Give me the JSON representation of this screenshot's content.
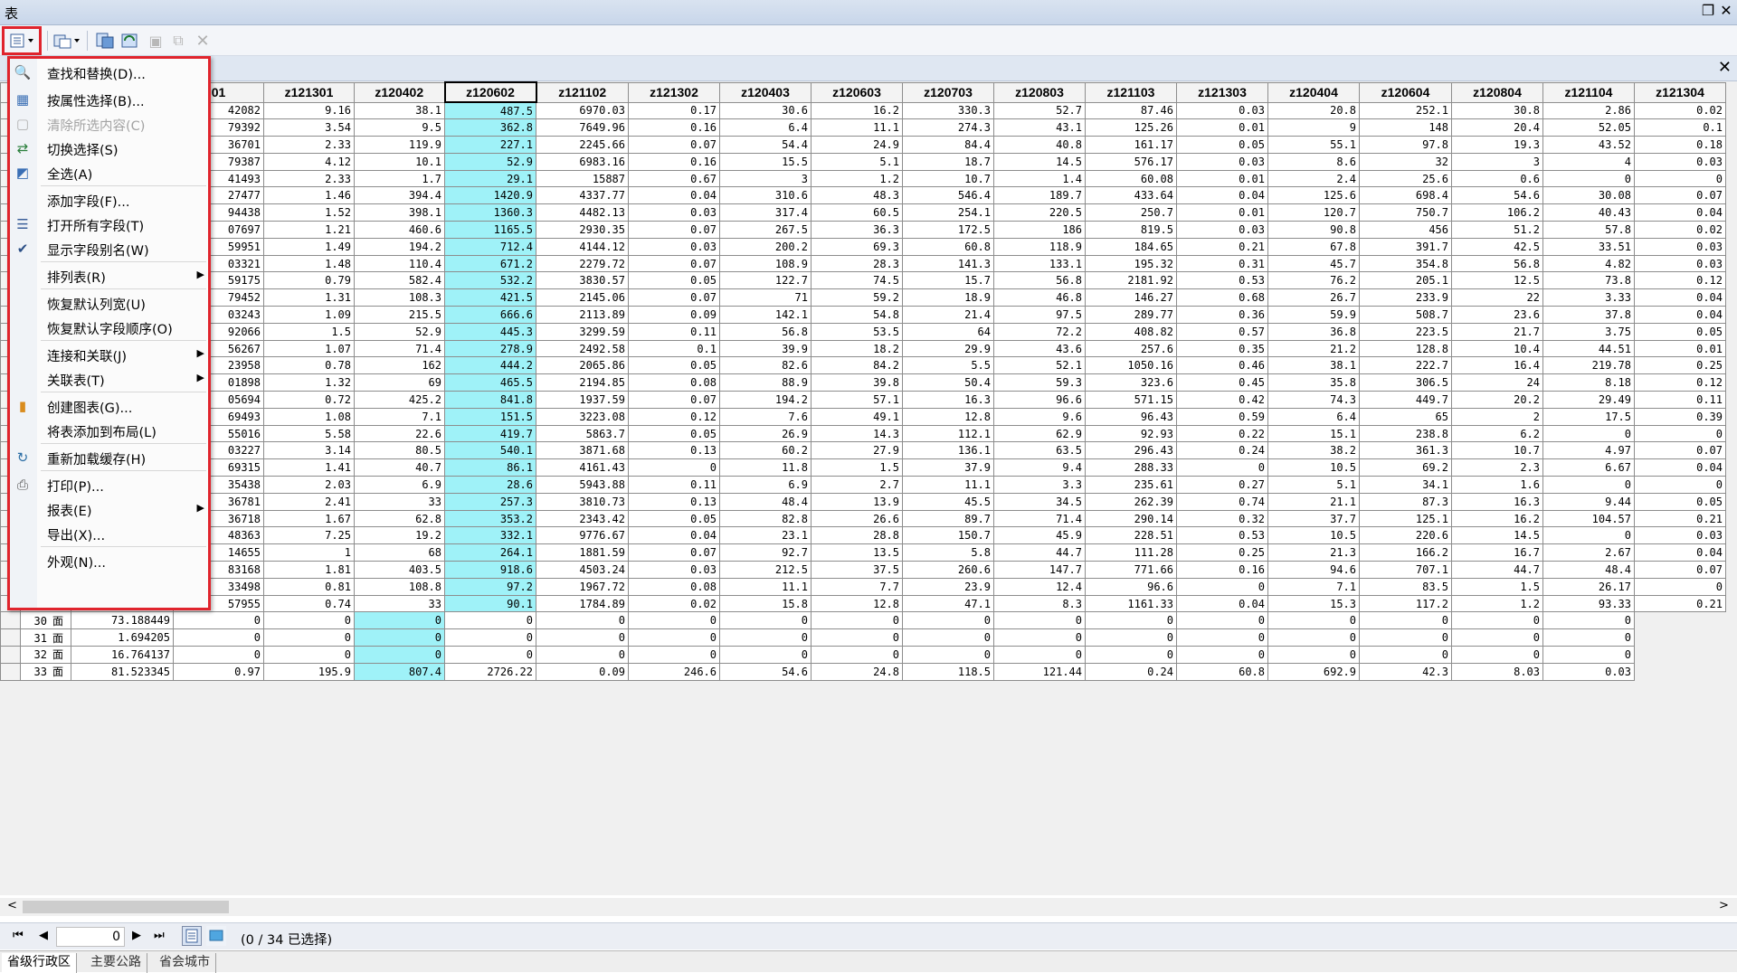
{
  "window": {
    "title": "表",
    "restore_icon": "restore-icon",
    "close_icon": "close-icon"
  },
  "toolbar": {
    "options_icon": "table-options-icon",
    "related_icon": "related-tables-icon",
    "select_icons": [
      "select-by-attributes-icon",
      "switch-selection-icon",
      "clear-selection-icon",
      "zoom-to-selected-icon",
      "delete-icon"
    ]
  },
  "menu": {
    "items": [
      {
        "label": "查找和替换(D)...",
        "icon": "binoculars-icon",
        "enabled": true
      },
      {
        "label": "按属性选择(B)...",
        "icon": "select-attributes-icon",
        "enabled": true
      },
      {
        "label": "清除所选内容(C)",
        "icon": "clear-selection-icon",
        "enabled": false
      },
      {
        "label": "切换选择(S)",
        "icon": "switch-selection-icon",
        "enabled": true
      },
      {
        "label": "全选(A)",
        "icon": "select-all-icon",
        "enabled": true
      },
      {
        "label": "添加字段(F)...",
        "icon": "",
        "enabled": true
      },
      {
        "label": "打开所有字段(T)",
        "icon": "fields-icon",
        "enabled": true
      },
      {
        "label": "显示字段别名(W)",
        "icon": "check-icon",
        "enabled": true
      },
      {
        "label": "排列表(R)",
        "icon": "",
        "enabled": true,
        "submenu": true
      },
      {
        "label": "恢复默认列宽(U)",
        "icon": "",
        "enabled": true
      },
      {
        "label": "恢复默认字段顺序(O)",
        "icon": "",
        "enabled": true
      },
      {
        "label": "连接和关联(J)",
        "icon": "",
        "enabled": true,
        "submenu": true
      },
      {
        "label": "关联表(T)",
        "icon": "",
        "enabled": true,
        "submenu": true
      },
      {
        "label": "创建图表(G)...",
        "icon": "chart-icon",
        "enabled": true
      },
      {
        "label": "将表添加到布局(L)",
        "icon": "",
        "enabled": true
      },
      {
        "label": "重新加载缓存(H)",
        "icon": "reload-icon",
        "enabled": true
      },
      {
        "label": "打印(P)...",
        "icon": "print-icon",
        "enabled": true
      },
      {
        "label": "报表(E)",
        "icon": "",
        "enabled": true,
        "submenu": true
      },
      {
        "label": "导出(X)...",
        "icon": "",
        "enabled": true
      },
      {
        "label": "外观(N)...",
        "icon": "",
        "enabled": true
      }
    ]
  },
  "table": {
    "columns": [
      "01",
      "z121301",
      "z120402",
      "z120602",
      "z121102",
      "z121302",
      "z120403",
      "z120603",
      "z120703",
      "z120803",
      "z121103",
      "z121303",
      "z120404",
      "z120604",
      "z120804",
      "z121104",
      "z121304"
    ],
    "selected_column": "z120602",
    "rows": [
      [
        "42082",
        "9.16",
        "38.1",
        "487.5",
        "6970.03",
        "0.17",
        "30.6",
        "16.2",
        "330.3",
        "52.7",
        "87.46",
        "0.03",
        "20.8",
        "252.1",
        "30.8",
        "2.86",
        "0.02"
      ],
      [
        "79392",
        "3.54",
        "9.5",
        "362.8",
        "7649.96",
        "0.16",
        "6.4",
        "11.1",
        "274.3",
        "43.1",
        "125.26",
        "0.01",
        "9",
        "148",
        "20.4",
        "52.05",
        "0.1"
      ],
      [
        "36701",
        "2.33",
        "119.9",
        "227.1",
        "2245.66",
        "0.07",
        "54.4",
        "24.9",
        "84.4",
        "40.8",
        "161.17",
        "0.05",
        "55.1",
        "97.8",
        "19.3",
        "43.52",
        "0.18"
      ],
      [
        "79387",
        "4.12",
        "10.1",
        "52.9",
        "6983.16",
        "0.16",
        "15.5",
        "5.1",
        "18.7",
        "14.5",
        "576.17",
        "0.03",
        "8.6",
        "32",
        "3",
        "4",
        "0.03"
      ],
      [
        "41493",
        "2.33",
        "1.7",
        "29.1",
        "15887",
        "0.67",
        "3",
        "1.2",
        "10.7",
        "1.4",
        "60.08",
        "0.01",
        "2.4",
        "25.6",
        "0.6",
        "0",
        "0"
      ],
      [
        "27477",
        "1.46",
        "394.4",
        "1420.9",
        "4337.77",
        "0.04",
        "310.6",
        "48.3",
        "546.4",
        "189.7",
        "433.64",
        "0.04",
        "125.6",
        "698.4",
        "54.6",
        "30.08",
        "0.07"
      ],
      [
        "94438",
        "1.52",
        "398.1",
        "1360.3",
        "4482.13",
        "0.03",
        "317.4",
        "60.5",
        "254.1",
        "220.5",
        "250.7",
        "0.01",
        "120.7",
        "750.7",
        "106.2",
        "40.43",
        "0.04"
      ],
      [
        "07697",
        "1.21",
        "460.6",
        "1165.5",
        "2930.35",
        "0.07",
        "267.5",
        "36.3",
        "172.5",
        "186",
        "819.5",
        "0.03",
        "90.8",
        "456",
        "51.2",
        "57.8",
        "0.02"
      ],
      [
        "59951",
        "1.49",
        "194.2",
        "712.4",
        "4144.12",
        "0.03",
        "200.2",
        "69.3",
        "60.8",
        "118.9",
        "184.65",
        "0.21",
        "67.8",
        "391.7",
        "42.5",
        "33.51",
        "0.03"
      ],
      [
        "03321",
        "1.48",
        "110.4",
        "671.2",
        "2279.72",
        "0.07",
        "108.9",
        "28.3",
        "141.3",
        "133.1",
        "195.32",
        "0.31",
        "45.7",
        "354.8",
        "56.8",
        "4.82",
        "0.03"
      ],
      [
        "59175",
        "0.79",
        "582.4",
        "532.2",
        "3830.57",
        "0.05",
        "122.7",
        "74.5",
        "15.7",
        "56.8",
        "2181.92",
        "0.53",
        "76.2",
        "205.1",
        "12.5",
        "73.8",
        "0.12"
      ],
      [
        "79452",
        "1.31",
        "108.3",
        "421.5",
        "2145.06",
        "0.07",
        "71",
        "59.2",
        "18.9",
        "46.8",
        "146.27",
        "0.68",
        "26.7",
        "233.9",
        "22",
        "3.33",
        "0.04"
      ],
      [
        "03243",
        "1.09",
        "215.5",
        "666.6",
        "2113.89",
        "0.09",
        "142.1",
        "54.8",
        "21.4",
        "97.5",
        "289.77",
        "0.36",
        "59.9",
        "508.7",
        "23.6",
        "37.8",
        "0.04"
      ],
      [
        "92066",
        "1.5",
        "52.9",
        "445.3",
        "3299.59",
        "0.11",
        "56.8",
        "53.5",
        "64",
        "72.2",
        "408.82",
        "0.57",
        "36.8",
        "223.5",
        "21.7",
        "3.75",
        "0.05"
      ],
      [
        "56267",
        "1.07",
        "71.4",
        "278.9",
        "2492.58",
        "0.1",
        "39.9",
        "18.2",
        "29.9",
        "43.6",
        "257.6",
        "0.35",
        "21.2",
        "128.8",
        "10.4",
        "44.51",
        "0.01"
      ],
      [
        "23958",
        "0.78",
        "162",
        "444.2",
        "2065.86",
        "0.05",
        "82.6",
        "84.2",
        "5.5",
        "52.1",
        "1050.16",
        "0.46",
        "38.1",
        "222.7",
        "16.4",
        "219.78",
        "0.25"
      ],
      [
        "01898",
        "1.32",
        "69",
        "465.5",
        "2194.85",
        "0.08",
        "88.9",
        "39.8",
        "50.4",
        "59.3",
        "323.6",
        "0.45",
        "35.8",
        "306.5",
        "24",
        "8.18",
        "0.12"
      ],
      [
        "05694",
        "0.72",
        "425.2",
        "841.8",
        "1937.59",
        "0.07",
        "194.2",
        "57.1",
        "16.3",
        "96.6",
        "571.15",
        "0.42",
        "74.3",
        "449.7",
        "20.2",
        "29.49",
        "0.11"
      ],
      [
        "69493",
        "1.08",
        "7.1",
        "151.5",
        "3223.08",
        "0.12",
        "7.6",
        "49.1",
        "12.8",
        "9.6",
        "96.43",
        "0.59",
        "6.4",
        "65",
        "2",
        "17.5",
        "0.39"
      ],
      [
        "55016",
        "5.58",
        "22.6",
        "419.7",
        "5863.7",
        "0.05",
        "26.9",
        "14.3",
        "112.1",
        "62.9",
        "92.93",
        "0.22",
        "15.1",
        "238.8",
        "6.2",
        "0",
        "0"
      ],
      [
        "03227",
        "3.14",
        "80.5",
        "540.1",
        "3871.68",
        "0.13",
        "60.2",
        "27.9",
        "136.1",
        "63.5",
        "296.43",
        "0.24",
        "38.2",
        "361.3",
        "10.7",
        "4.97",
        "0.07"
      ],
      [
        "69315",
        "1.41",
        "40.7",
        "86.1",
        "4161.43",
        "0",
        "11.8",
        "1.5",
        "37.9",
        "9.4",
        "288.33",
        "0",
        "10.5",
        "69.2",
        "2.3",
        "6.67",
        "0.04"
      ],
      [
        "35438",
        "2.03",
        "6.9",
        "28.6",
        "5943.88",
        "0.11",
        "6.9",
        "2.7",
        "11.1",
        "3.3",
        "235.61",
        "0.27",
        "5.1",
        "34.1",
        "1.6",
        "0",
        "0"
      ],
      [
        "36781",
        "2.41",
        "33",
        "257.3",
        "3810.73",
        "0.13",
        "48.4",
        "13.9",
        "45.5",
        "34.5",
        "262.39",
        "0.74",
        "21.1",
        "87.3",
        "16.3",
        "9.44",
        "0.05"
      ],
      [
        "36718",
        "1.67",
        "62.8",
        "353.2",
        "2343.42",
        "0.05",
        "82.8",
        "26.6",
        "89.7",
        "71.4",
        "290.14",
        "0.32",
        "37.7",
        "125.1",
        "16.2",
        "104.57",
        "0.21"
      ],
      [
        "48363",
        "7.25",
        "19.2",
        "332.1",
        "9776.67",
        "0.04",
        "23.1",
        "28.8",
        "150.7",
        "45.9",
        "228.51",
        "0.53",
        "10.5",
        "220.6",
        "14.5",
        "0",
        "0.03"
      ],
      [
        "14655",
        "1",
        "68",
        "264.1",
        "1881.59",
        "0.07",
        "92.7",
        "13.5",
        "5.8",
        "44.7",
        "111.28",
        "0.25",
        "21.3",
        "166.2",
        "16.7",
        "2.67",
        "0.04"
      ],
      [
        "83168",
        "1.81",
        "403.5",
        "918.6",
        "4503.24",
        "0.03",
        "212.5",
        "37.5",
        "260.6",
        "147.7",
        "771.66",
        "0.16",
        "94.6",
        "707.1",
        "44.7",
        "48.4",
        "0.07"
      ],
      [
        "33498",
        "0.81",
        "108.8",
        "97.2",
        "1967.72",
        "0.08",
        "11.1",
        "7.7",
        "23.9",
        "12.4",
        "96.6",
        "0",
        "7.1",
        "83.5",
        "1.5",
        "26.17",
        "0"
      ],
      [
        "57955",
        "0.74",
        "33",
        "90.1",
        "1784.89",
        "0.02",
        "15.8",
        "12.8",
        "47.1",
        "8.3",
        "1161.33",
        "0.04",
        "15.3",
        "117.2",
        "1.2",
        "93.33",
        "0.21"
      ]
    ],
    "tail_rows": [
      {
        "id": "30",
        "shape": "面",
        "area": "73.188449",
        "vals": [
          "0",
          "0",
          "0",
          "0",
          "0",
          "0",
          "0",
          "0",
          "0",
          "0",
          "0",
          "0",
          "0",
          "0",
          "0",
          "0"
        ]
      },
      {
        "id": "31",
        "shape": "面",
        "area": "1.694205",
        "vals": [
          "0",
          "0",
          "0",
          "0",
          "0",
          "0",
          "0",
          "0",
          "0",
          "0",
          "0",
          "0",
          "0",
          "0",
          "0",
          "0"
        ]
      },
      {
        "id": "32",
        "shape": "面",
        "area": "16.764137",
        "vals": [
          "0",
          "0",
          "0",
          "0",
          "0",
          "0",
          "0",
          "0",
          "0",
          "0",
          "0",
          "0",
          "0",
          "0",
          "0",
          "0"
        ]
      },
      {
        "id": "33",
        "shape": "面",
        "area": "81.523345",
        "vals": [
          "0.97",
          "195.9",
          "807.4",
          "2726.22",
          "0.09",
          "246.6",
          "54.6",
          "24.8",
          "118.5",
          "121.44",
          "0.24",
          "60.8",
          "692.9",
          "42.3",
          "8.03",
          "0.03"
        ]
      }
    ]
  },
  "navigation": {
    "record": "0",
    "status": "(0 / 34 已选择)"
  },
  "bottom_tabs": [
    "省级行政区",
    "主要公路",
    "省会城市"
  ]
}
